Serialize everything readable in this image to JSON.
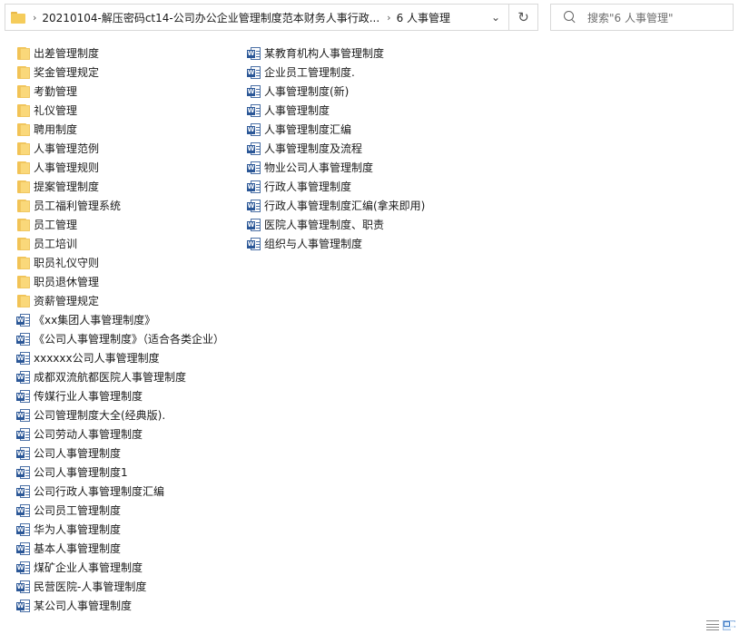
{
  "address_bar": {
    "crumbs": [
      "20210104-解压密码ct14-公司办公企业管理制度范本财务人事行政...",
      "6 人事管理"
    ],
    "dropdown_glyph": "⌄",
    "refresh_glyph": "↻"
  },
  "search": {
    "placeholder": "搜索\"6 人事管理\""
  },
  "files": {
    "column_1": [
      {
        "type": "folder",
        "name": "出差管理制度"
      },
      {
        "type": "folder",
        "name": "奖金管理规定"
      },
      {
        "type": "folder",
        "name": "考勤管理"
      },
      {
        "type": "folder",
        "name": "礼仪管理"
      },
      {
        "type": "folder",
        "name": "聘用制度"
      },
      {
        "type": "folder",
        "name": "人事管理范例"
      },
      {
        "type": "folder",
        "name": "人事管理规则"
      },
      {
        "type": "folder",
        "name": "提案管理制度"
      },
      {
        "type": "folder",
        "name": "员工福利管理系统"
      },
      {
        "type": "folder",
        "name": "员工管理"
      },
      {
        "type": "folder",
        "name": "员工培训"
      },
      {
        "type": "folder",
        "name": "职员礼仪守则"
      },
      {
        "type": "folder",
        "name": "职员退休管理"
      },
      {
        "type": "folder",
        "name": "资薪管理规定"
      },
      {
        "type": "doc",
        "name": "《xx集团人事管理制度》"
      },
      {
        "type": "doc",
        "name": "《公司人事管理制度》（适合各类企业）"
      },
      {
        "type": "doc",
        "name": "xxxxxx公司人事管理制度"
      },
      {
        "type": "doc",
        "name": "成都双流航都医院人事管理制度"
      },
      {
        "type": "doc",
        "name": "传媒行业人事管理制度"
      },
      {
        "type": "doc",
        "name": "公司管理制度大全(经典版)."
      },
      {
        "type": "doc",
        "name": "公司劳动人事管理制度"
      },
      {
        "type": "doc",
        "name": "公司人事管理制度"
      },
      {
        "type": "doc",
        "name": "公司人事管理制度1"
      },
      {
        "type": "doc",
        "name": "公司行政人事管理制度汇编"
      },
      {
        "type": "doc",
        "name": "公司员工管理制度"
      },
      {
        "type": "doc",
        "name": "华为人事管理制度"
      },
      {
        "type": "doc",
        "name": "基本人事管理制度"
      },
      {
        "type": "doc",
        "name": "煤矿企业人事管理制度"
      },
      {
        "type": "doc",
        "name": "民营医院-人事管理制度"
      },
      {
        "type": "doc",
        "name": "某公司人事管理制度"
      }
    ],
    "column_2": [
      {
        "type": "doc",
        "name": "某教育机构人事管理制度"
      },
      {
        "type": "doc",
        "name": "企业员工管理制度."
      },
      {
        "type": "doc",
        "name": "人事管理制度(新)"
      },
      {
        "type": "doc",
        "name": "人事管理制度"
      },
      {
        "type": "doc",
        "name": "人事管理制度汇编"
      },
      {
        "type": "doc",
        "name": "人事管理制度及流程"
      },
      {
        "type": "doc",
        "name": "物业公司人事管理制度"
      },
      {
        "type": "doc",
        "name": "行政人事管理制度"
      },
      {
        "type": "doc",
        "name": "行政人事管理制度汇编(拿来即用)"
      },
      {
        "type": "doc",
        "name": "医院人事管理制度、职责"
      },
      {
        "type": "doc",
        "name": "组织与人事管理制度"
      }
    ]
  },
  "icons": {
    "folder": "folder-icon",
    "doc": "word-document-icon",
    "w_letter": "W"
  },
  "colors": {
    "folder": "#f5cc5b",
    "word": "#2b5797"
  }
}
